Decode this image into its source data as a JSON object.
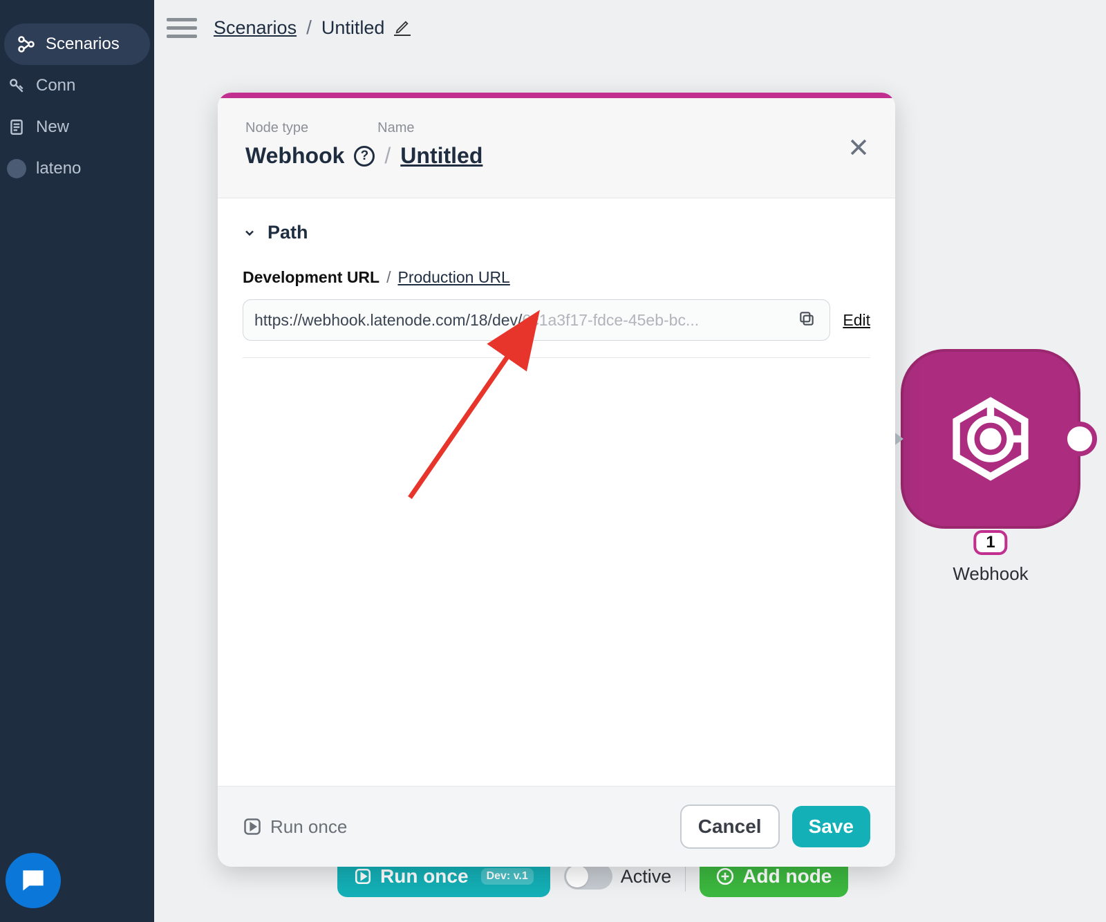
{
  "sidebar": {
    "items": [
      {
        "label": "Scenarios"
      },
      {
        "label": "Conn"
      },
      {
        "label": "New"
      },
      {
        "label": "lateno"
      }
    ]
  },
  "topbar": {
    "scenarios_link": "Scenarios",
    "separator": "/",
    "title": "Untitled"
  },
  "canvas_node": {
    "badge": "1",
    "label": "Webhook"
  },
  "bottom_bar": {
    "run_once": "Run once",
    "dev_badge": "Dev: v.1",
    "active_label": "Active",
    "add_node": "Add node"
  },
  "modal": {
    "node_type_label": "Node type",
    "name_label": "Name",
    "node_type_value": "Webhook",
    "name_value": "Untitled",
    "section_title": "Path",
    "url_tabs": {
      "dev": "Development URL",
      "separator": "/",
      "prod": "Production URL"
    },
    "url_value_prefix": "https://webhook.latenode.com/18/dev/",
    "url_value_suffix": "6c1a3f17-fdce-45eb-bc...",
    "edit_link": "Edit",
    "footer": {
      "run_once": "Run once",
      "cancel": "Cancel",
      "save": "Save"
    }
  }
}
